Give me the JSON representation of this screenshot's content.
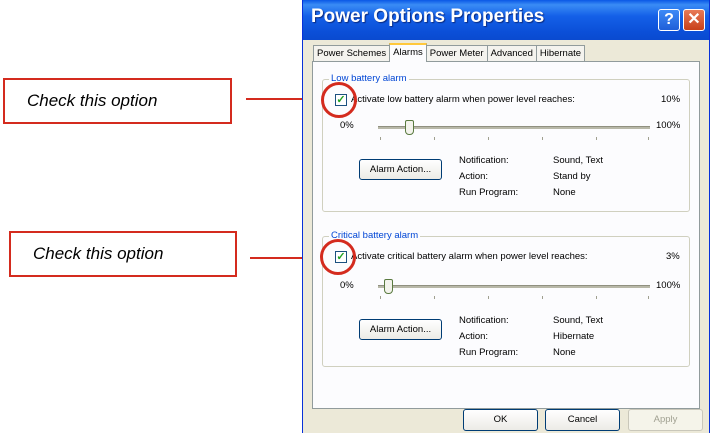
{
  "window": {
    "title": "Power Options Properties",
    "help_label": "?",
    "close_label": "✕"
  },
  "tabs": [
    "Power Schemes",
    "Alarms",
    "Power Meter",
    "Advanced",
    "Hibernate"
  ],
  "low_alarm": {
    "legend": "Low battery alarm",
    "checkbox_label": "Activate low battery alarm when power level reaches:",
    "checked": true,
    "level": "10%",
    "level_value": 10,
    "slider_min": "0%",
    "slider_max": "100%",
    "button": "Alarm Action...",
    "notification_label": "Notification:",
    "notification_value": "Sound, Text",
    "action_label": "Action:",
    "action_value": "Stand by",
    "run_label": "Run Program:",
    "run_value": "None"
  },
  "critical_alarm": {
    "legend": "Critical battery alarm",
    "checkbox_label": "Activate critical battery alarm when power level reaches:",
    "checked": true,
    "level": "3%",
    "level_value": 3,
    "slider_min": "0%",
    "slider_max": "100%",
    "button": "Alarm Action...",
    "notification_label": "Notification:",
    "notification_value": "Sound, Text",
    "action_label": "Action:",
    "action_value": "Hibernate",
    "run_label": "Run Program:",
    "run_value": "None"
  },
  "footer": {
    "ok": "OK",
    "cancel": "Cancel",
    "apply": "Apply"
  },
  "callouts": {
    "top": "Check this option",
    "bottom": "Check this option"
  },
  "colors": {
    "callout": "#d42b1e",
    "titlebar": "#0a58e6"
  }
}
